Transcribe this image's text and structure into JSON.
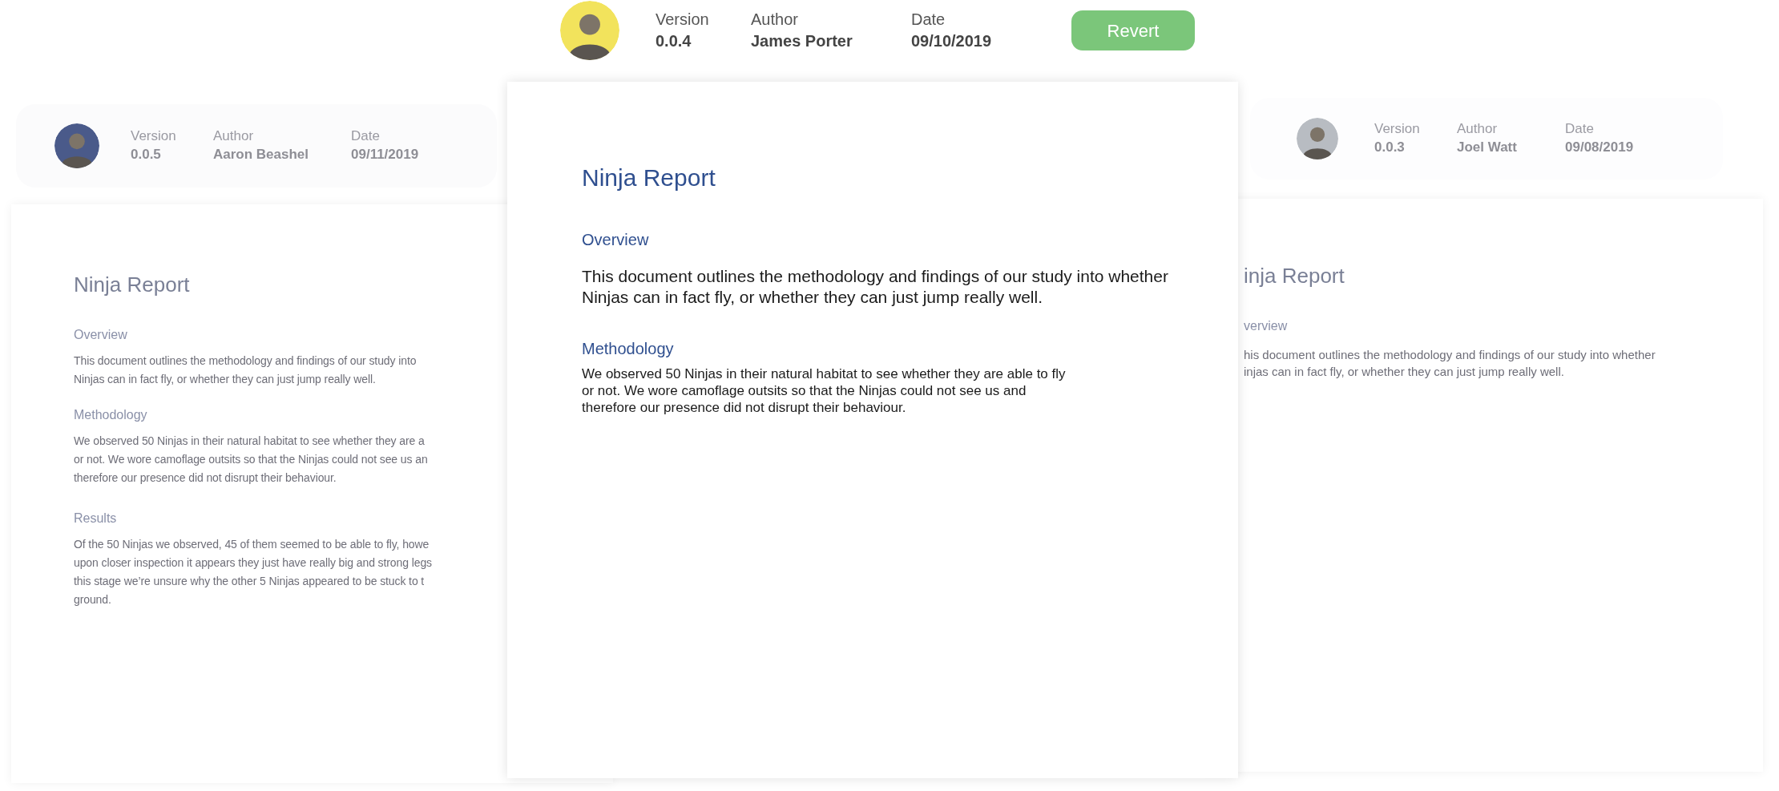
{
  "versions": [
    {
      "selected": true,
      "color": "#f2e35c",
      "version_label": "Version",
      "version": "0.0.4",
      "author_label": "Author",
      "author": "James Porter",
      "date_label": "Date",
      "date": "09/10/2019",
      "action": "Revert",
      "document": {
        "title": "Ninja Report",
        "sections": [
          {
            "kind": "lead",
            "heading": "Overview",
            "lines": [
              "This document outlines the methodology and findings of our study into whether",
              "Ninjas can in fact fly, or whether they can just jump really well."
            ]
          },
          {
            "kind": "body",
            "heading": "Methodology",
            "lines": [
              "We observed 50 Ninjas in their natural habitat to see whether they are able to fly",
              "or not. We wore camoflage outsits so that the Ninjas could not see us and",
              "therefore our presence did not disrupt their behaviour."
            ]
          }
        ]
      }
    },
    {
      "selected": false,
      "color": "#4a5a8a",
      "version_label": "Version",
      "version": "0.0.5",
      "author_label": "Author",
      "author": "Aaron Beashel",
      "date_label": "Date",
      "date": "09/11/2019",
      "document": {
        "title": "Ninja Report",
        "sections": [
          {
            "kind": "body",
            "heading": "Overview",
            "lines": [
              "This document outlines the methodology and findings of our study into",
              "Ninjas can in fact fly, or whether they can just jump really well."
            ]
          },
          {
            "kind": "body",
            "heading": "Methodology",
            "lines": [
              "We observed 50 Ninjas in their natural habitat to see whether they are a",
              "or not. We wore camoflage outsits so that the Ninjas could not see us an",
              "therefore our presence did not disrupt their behaviour."
            ]
          },
          {
            "kind": "body",
            "heading": "Results",
            "lines": [
              "Of the 50 Ninjas we observed, 45 of them seemed to be able to fly, howe",
              "upon closer inspection it appears they just have really big and strong legs",
              "this stage we’re unsure why the other 5 Ninjas appeared to be stuck to t",
              "ground."
            ]
          }
        ]
      }
    },
    {
      "selected": false,
      "color": "#b8bcc2",
      "version_label": "Version",
      "version": "0.0.3",
      "author_label": "Author",
      "author": "Joel Watt",
      "date_label": "Date",
      "date": "09/08/2019",
      "document": {
        "title": "inja Report",
        "sections": [
          {
            "kind": "body",
            "heading": "verview",
            "lines": [
              "his document outlines the methodology and findings of our study into whether",
              "injas can in fact fly, or whether they can just jump really well."
            ]
          }
        ]
      }
    }
  ]
}
